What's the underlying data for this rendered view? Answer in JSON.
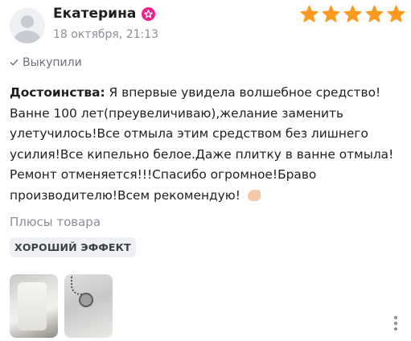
{
  "review": {
    "author": "Екатерина",
    "date": "18 октября, 21:13",
    "rating": 5,
    "bought_label": "Выкупили",
    "advantages_label": "Достоинства:",
    "advantages_text": "Я впервые увидела волшебное средство! Ванне 100 лет(преувеличиваю),желание заменить улетучилось!Все отмыла этим средством без лишнего усилия!Все кипельно белое.Даже плитку в ванне отмыла!Ремонт отменяется!!!Спасибо огромное!Браво производителю!Всем рекомендую!",
    "pros_title": "Плюсы товара",
    "tags": [
      "ХОРОШИЙ ЭФФЕКТ"
    ],
    "photos": [
      {
        "icon": "bathtub-photo"
      },
      {
        "icon": "bathtub-drain-photo"
      }
    ]
  },
  "colors": {
    "star": "#ff9a1f",
    "badge": "#f51e8d",
    "muted_text": "#8c8f96",
    "tag_bg": "#eef0f4"
  }
}
